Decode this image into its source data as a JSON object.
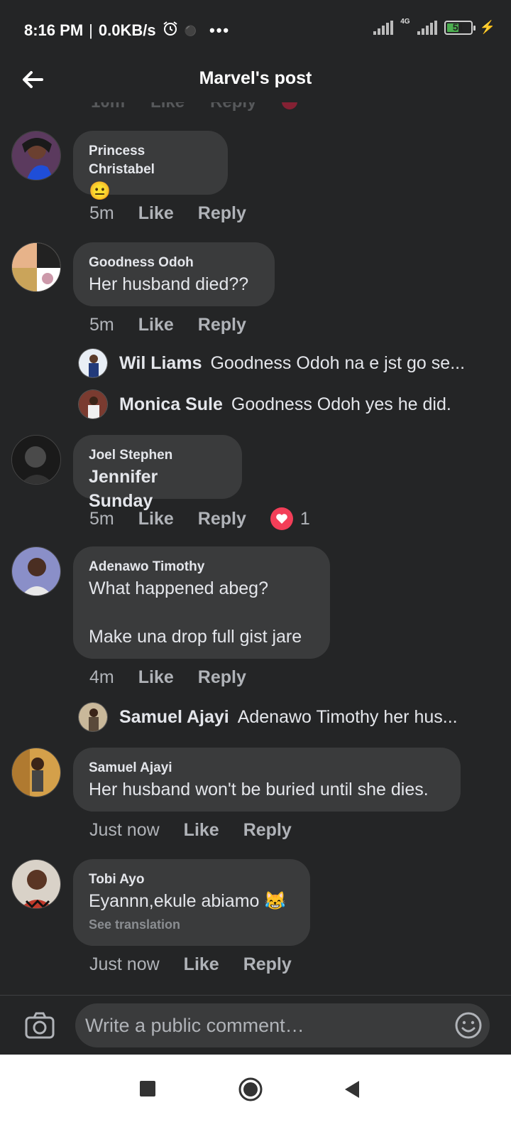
{
  "status_bar": {
    "time": "8:16 PM",
    "speed": "0.0KB/s",
    "network": "4G",
    "battery": "51",
    "alarm_icon": "alarm-icon",
    "more": "•••"
  },
  "header": {
    "title": "Marvel's post",
    "back_icon": "back-arrow-icon"
  },
  "ghost": {
    "time": "10m",
    "like": "Like",
    "reply": "Reply"
  },
  "comments": [
    {
      "author": "Princess Christabel",
      "text": "😐",
      "time": "5m",
      "like": "Like",
      "reply": "Reply"
    },
    {
      "author": "Goodness Odoh",
      "text": "Her husband died??",
      "time": "5m",
      "like": "Like",
      "reply": "Reply"
    },
    {
      "author": "Joel Stephen",
      "text": "Jennifer Sunday",
      "time": "5m",
      "like": "Like",
      "reply": "Reply",
      "reaction_count": "1"
    },
    {
      "author": "Adenawo Timothy",
      "text": "What happened abeg?\n\nMake una drop full gist jare",
      "time": "4m",
      "like": "Like",
      "reply": "Reply"
    },
    {
      "author": "Samuel Ajayi",
      "text": "Her husband won't be buried until she dies.",
      "time": "Just now",
      "like": "Like",
      "reply": "Reply"
    },
    {
      "author": "Tobi Ayo",
      "text": "Eyannn,ekule abiamo 😹",
      "translation": "See translation",
      "time": "Just now",
      "like": "Like",
      "reply": "Reply"
    }
  ],
  "replies": [
    {
      "name": "Wil Liams",
      "text": "Goodness Odoh na e jst go se..."
    },
    {
      "name": "Monica Sule",
      "text": "Goodness Odoh yes he did."
    },
    {
      "name": "Samuel Ajayi",
      "text": "Adenawo Timothy her hus..."
    }
  ],
  "composer": {
    "placeholder": "Write a public comment…",
    "camera_icon": "camera-icon",
    "emoji_icon": "emoji-icon"
  },
  "colors": {
    "background": "#242526",
    "bubble": "#3a3b3c",
    "text": "#e4e6eb",
    "muted": "#b0b3b8",
    "heart": "#f33e58",
    "battery": "#4caf50"
  }
}
